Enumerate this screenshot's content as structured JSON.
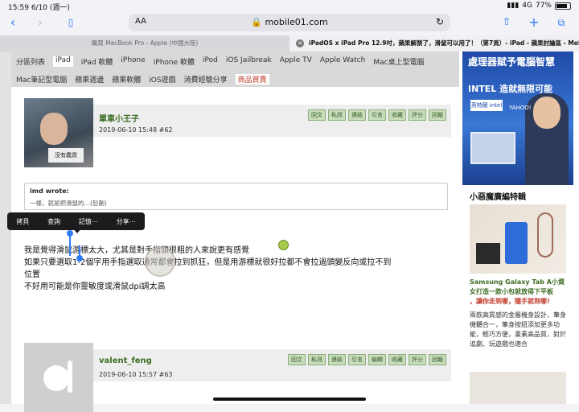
{
  "status": {
    "time": "15:59",
    "date": "6/10 (週一)",
    "network": "4G",
    "battery": "77%"
  },
  "browser": {
    "aa": "AA",
    "host": "mobile01.com",
    "tabs": [
      {
        "label": "購買 MacBook Pro - Apple (中國大陸)"
      },
      {
        "label": "iPadOS x iPad Pro 12.9吋，蘋果解禁了，滑鼠可以用了！（第7頁）- iPad - 蘋果討論區 - Mobile01"
      }
    ]
  },
  "nav": {
    "row1": [
      "分區列表",
      "iPad",
      "iPad 軟體",
      "iPhone",
      "iPhone 軟體",
      "iPod",
      "iOS Jailbreak",
      "Apple TV",
      "Apple Watch",
      "Mac桌上型電腦"
    ],
    "row2": [
      "Mac筆記型電腦",
      "蘋果週邊",
      "蘋果軟體",
      "iOS遊戲",
      "消費經驗分享",
      "商品買賣"
    ]
  },
  "post_actions": [
    "回文",
    "私訊",
    "連結",
    "引言",
    "收藏",
    "評分",
    "回報"
  ],
  "post_actions2": [
    "回文",
    "私訊",
    "連結",
    "引言",
    "編輯",
    "收藏",
    "評分",
    "回報"
  ],
  "posts": [
    {
      "author": "單車小王子",
      "meta": "2019-06-10 15:48  #62",
      "avatar_sign": "沒有蠢貨",
      "quote_author": "imd wrote:",
      "quote_text": "一樣，就是把滑鼠的…(恕刪)",
      "lines": [
        "我是覺得滑鼠游標太大，尤其是對手指頭很粗的人來說更有感覺",
        "如果只要選取1-2個字用手指選取通常都會拉到抓狂，但是用游標就很好拉都不會拉過頭變反向或拉不到",
        "位置",
        "不好用可能是你靈敏度或滑鼠dpi調太高"
      ]
    },
    {
      "author": "valent_feng",
      "meta": "2019-06-10 15:57  #63"
    }
  ],
  "context_menu": [
    "拷貝",
    "查詢",
    "記憶⋯",
    "分享⋯"
  ],
  "sidebar": {
    "ad_line1": "處理器賦予電腦智慧",
    "ad_line2": "INTEL 造就無限可能",
    "ad_badge": "英特爾 intel",
    "ad_partner": "YAHOO!",
    "section_title": "小惡魔廣編特輯",
    "link": "Samsung Galaxy Tab A小資女打造一款小包就放得下平板",
    "link_red": "，讓你走到哪，隨手就到哪!",
    "desc": "兩款高質感的金屬機身設計，筆身機體合一，筆身按鈕添加更多功能，輕巧方便，畫素高品質，對於追劇、玩遊戲也適合"
  }
}
